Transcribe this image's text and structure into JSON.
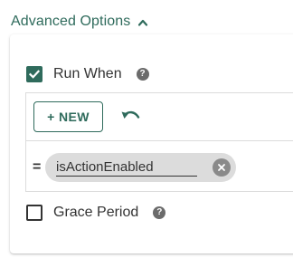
{
  "header": {
    "title": "Advanced Options",
    "toggle_icon": "chevron-up-icon"
  },
  "run_when": {
    "label": "Run When",
    "checked": true,
    "help_icon": "help-icon",
    "help_glyph": "?"
  },
  "condition": {
    "new_button_label": "+ NEW",
    "undo_icon": "undo-icon",
    "operator": "=",
    "expression_chip": "isActionEnabled",
    "remove_icon": "close-circle-icon"
  },
  "grace_period": {
    "label": "Grace Period",
    "checked": false,
    "help_icon": "help-icon",
    "help_glyph": "?"
  },
  "colors": {
    "accent": "#2f6b5c",
    "chip_bg": "#dcdcdc",
    "text": "#333333",
    "help_icon_bg": "#6b6b6b"
  }
}
